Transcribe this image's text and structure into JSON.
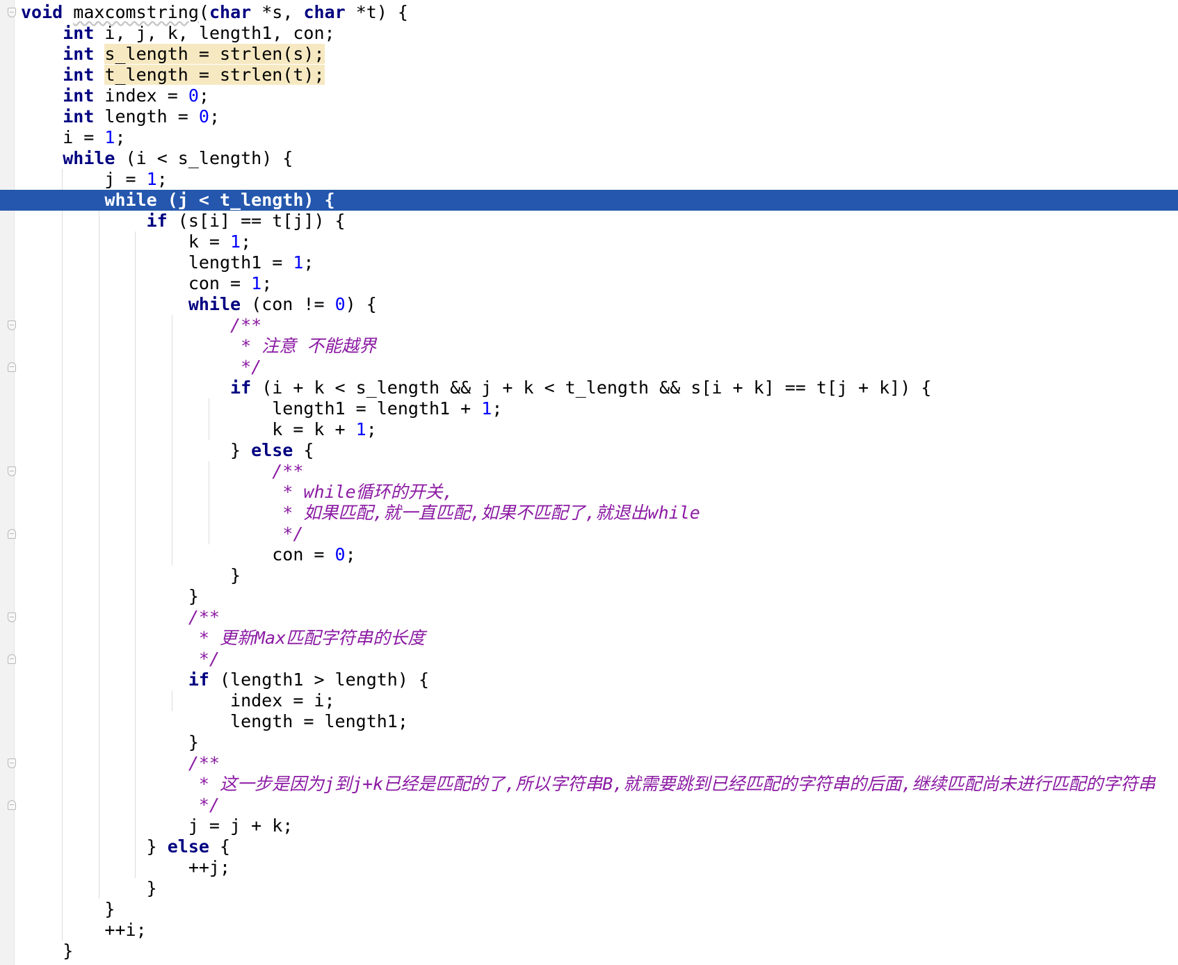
{
  "editor": {
    "current_line": 9,
    "lines": [
      [
        {
          "t": "void",
          "c": "kw"
        },
        {
          "t": " "
        },
        {
          "t": "maxcomstring",
          "c": "fn"
        },
        {
          "t": "("
        },
        {
          "t": "char",
          "c": "kw"
        },
        {
          "t": " *s, "
        },
        {
          "t": "char",
          "c": "kw"
        },
        {
          "t": " *t) {"
        }
      ],
      [
        {
          "t": "    "
        },
        {
          "t": "int",
          "c": "kw"
        },
        {
          "t": " i, j, k, length1, con;"
        }
      ],
      [
        {
          "t": "    "
        },
        {
          "t": "int",
          "c": "kw"
        },
        {
          "t": " "
        },
        {
          "t": "s_length = strlen(s);",
          "c": "hl"
        }
      ],
      [
        {
          "t": "    "
        },
        {
          "t": "int",
          "c": "kw"
        },
        {
          "t": " "
        },
        {
          "t": "t_length = strlen(t);",
          "c": "hl"
        }
      ],
      [
        {
          "t": "    "
        },
        {
          "t": "int",
          "c": "kw"
        },
        {
          "t": " index = "
        },
        {
          "t": "0",
          "c": "num"
        },
        {
          "t": ";"
        }
      ],
      [
        {
          "t": "    "
        },
        {
          "t": "int",
          "c": "kw"
        },
        {
          "t": " length = "
        },
        {
          "t": "0",
          "c": "num"
        },
        {
          "t": ";"
        }
      ],
      [
        {
          "t": "    i = "
        },
        {
          "t": "1",
          "c": "num"
        },
        {
          "t": ";"
        }
      ],
      [
        {
          "t": "    "
        },
        {
          "t": "while",
          "c": "kw"
        },
        {
          "t": " (i < s_length) {"
        }
      ],
      [
        {
          "t": "        j = "
        },
        {
          "t": "1",
          "c": "num"
        },
        {
          "t": ";"
        }
      ],
      [
        {
          "t": "        "
        },
        {
          "t": "while",
          "c": "kw"
        },
        {
          "t": " (j < t_length) {"
        }
      ],
      [
        {
          "t": "            "
        },
        {
          "t": "if",
          "c": "kw"
        },
        {
          "t": " (s[i] == t[j]) {"
        }
      ],
      [
        {
          "t": "                k = "
        },
        {
          "t": "1",
          "c": "num"
        },
        {
          "t": ";"
        }
      ],
      [
        {
          "t": "                length1 = "
        },
        {
          "t": "1",
          "c": "num"
        },
        {
          "t": ";"
        }
      ],
      [
        {
          "t": "                con = "
        },
        {
          "t": "1",
          "c": "num"
        },
        {
          "t": ";"
        }
      ],
      [
        {
          "t": "                "
        },
        {
          "t": "while",
          "c": "kw"
        },
        {
          "t": " (con != "
        },
        {
          "t": "0",
          "c": "num"
        },
        {
          "t": ") {"
        }
      ],
      [
        {
          "t": "                    "
        },
        {
          "t": "/**",
          "c": "cmt"
        }
      ],
      [
        {
          "t": "                     "
        },
        {
          "t": "* 注意 不能越界",
          "c": "cmt"
        }
      ],
      [
        {
          "t": "                     "
        },
        {
          "t": "*/",
          "c": "cmt"
        }
      ],
      [
        {
          "t": "                    "
        },
        {
          "t": "if",
          "c": "kw"
        },
        {
          "t": " (i + k < s_length && j + k < t_length && s[i + k] == t[j + k]) {"
        }
      ],
      [
        {
          "t": "                        length1 = length1 + "
        },
        {
          "t": "1",
          "c": "num"
        },
        {
          "t": ";"
        }
      ],
      [
        {
          "t": "                        k = k + "
        },
        {
          "t": "1",
          "c": "num"
        },
        {
          "t": ";"
        }
      ],
      [
        {
          "t": "                    } "
        },
        {
          "t": "else",
          "c": "kw"
        },
        {
          "t": " {"
        }
      ],
      [
        {
          "t": "                        "
        },
        {
          "t": "/**",
          "c": "cmt"
        }
      ],
      [
        {
          "t": "                         "
        },
        {
          "t": "* while循环的开关,",
          "c": "cmt"
        }
      ],
      [
        {
          "t": "                         "
        },
        {
          "t": "* 如果匹配,就一直匹配,如果不匹配了,就退出while",
          "c": "cmt"
        }
      ],
      [
        {
          "t": "                         "
        },
        {
          "t": "*/",
          "c": "cmt"
        }
      ],
      [
        {
          "t": "                        con = "
        },
        {
          "t": "0",
          "c": "num"
        },
        {
          "t": ";"
        }
      ],
      [
        {
          "t": "                    }"
        }
      ],
      [
        {
          "t": "                }"
        }
      ],
      [
        {
          "t": "                "
        },
        {
          "t": "/**",
          "c": "cmt"
        }
      ],
      [
        {
          "t": "                 "
        },
        {
          "t": "* 更新Max匹配字符串的长度",
          "c": "cmt"
        }
      ],
      [
        {
          "t": "                 "
        },
        {
          "t": "*/",
          "c": "cmt"
        }
      ],
      [
        {
          "t": "                "
        },
        {
          "t": "if",
          "c": "kw"
        },
        {
          "t": " (length1 > length) {"
        }
      ],
      [
        {
          "t": "                    index = i;"
        }
      ],
      [
        {
          "t": "                    length = length1;"
        }
      ],
      [
        {
          "t": "                }"
        }
      ],
      [
        {
          "t": "                "
        },
        {
          "t": "/**",
          "c": "cmt"
        }
      ],
      [
        {
          "t": "                 "
        },
        {
          "t": "* 这一步是因为j到j+k已经是匹配的了,所以字符串B,就需要跳到已经匹配的字符串的后面,继续匹配尚未进行匹配的字符串",
          "c": "cmt"
        }
      ],
      [
        {
          "t": "                 "
        },
        {
          "t": "*/",
          "c": "cmt"
        }
      ],
      [
        {
          "t": "                j = j + k;"
        }
      ],
      [
        {
          "t": "            } "
        },
        {
          "t": "else",
          "c": "kw"
        },
        {
          "t": " {"
        }
      ],
      [
        {
          "t": "                ++j;"
        }
      ],
      [
        {
          "t": "            }"
        }
      ],
      [
        {
          "t": "        }"
        }
      ],
      [
        {
          "t": "        ++i;"
        }
      ],
      [
        {
          "t": "    }"
        }
      ]
    ]
  }
}
